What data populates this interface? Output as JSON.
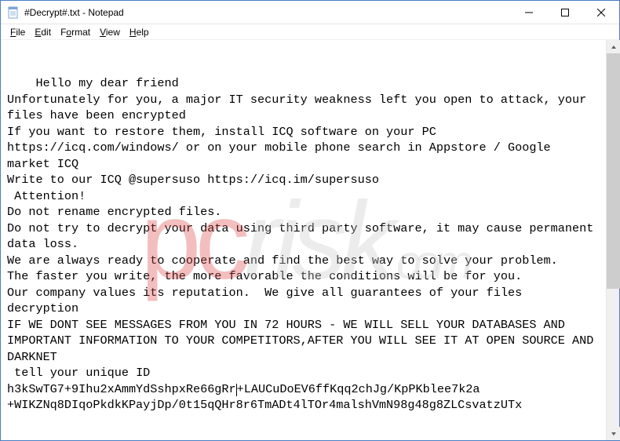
{
  "window": {
    "title": "#Decrypt#.txt - Notepad"
  },
  "menu": {
    "file": "File",
    "edit": "Edit",
    "format": "Format",
    "view": "View",
    "help": "Help"
  },
  "body": {
    "l1": "Hello my dear friend",
    "l2": "Unfortunately for you, a major IT security weakness left you open to attack, your files have been encrypted",
    "l3": "If you want to restore them, install ICQ software on your PC https://icq.com/windows/ or on your mobile phone search in Appstore / Google market ICQ",
    "l4": "Write to our ICQ @supersuso https://icq.im/supersuso",
    "l5": " Attention!",
    "l6": "Do not rename encrypted files.",
    "l7": "Do not try to decrypt your data using third party software, it may cause permanent data loss.",
    "l8": "We are always ready to cooperate and find the best way to solve your problem.",
    "l9": "The faster you write, the more favorable the conditions will be for you.",
    "l10": "Our company values its reputation.  We give all guarantees of your files decryption",
    "l11": "IF WE DONT SEE MESSAGES FROM YOU IN 72 HOURS - WE WILL SELL YOUR DATABASES AND IMPORTANT INFORMATION TO YOUR COMPETITORS,AFTER YOU WILL SEE IT AT OPEN SOURCE AND DARKNET",
    "l12": " tell your unique ID",
    "l13a": "h3kSwTG7+9Ihu2xAmmYdSshpxRe66gRr",
    "l13b": "+LAUCuDoEV6ffKqq2chJg/KpPKblee7k2a",
    "l14": "+WIKZNq8DIqoPkdkKPayjDp/0t15qQHr8r6TmADt4lTOr4malshVmN98g48g8ZLCsvatzUTx"
  },
  "watermark": "pcrisk.com"
}
